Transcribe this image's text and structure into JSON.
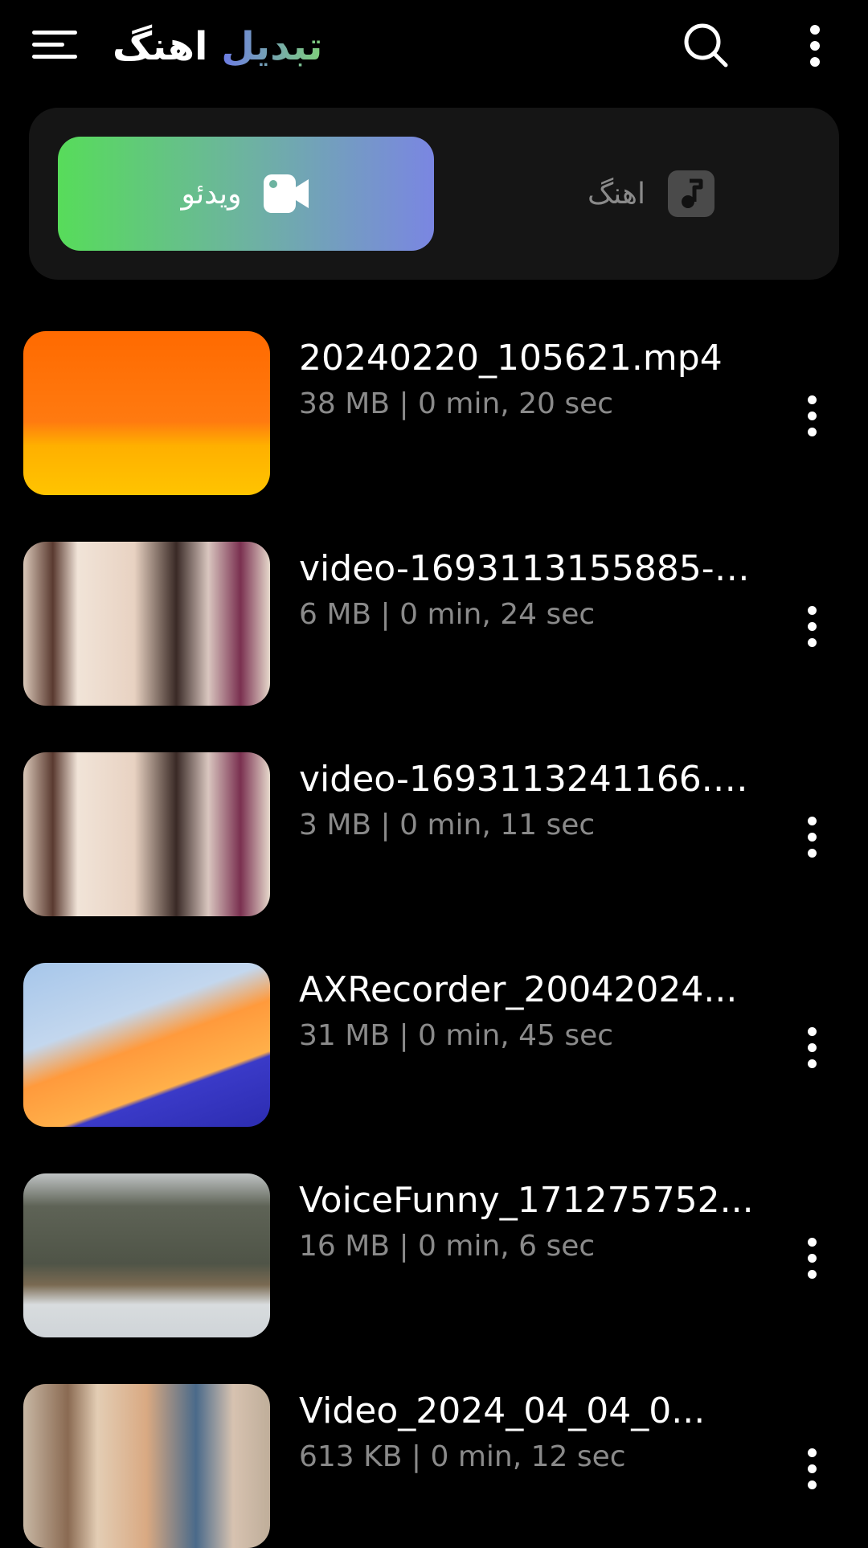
{
  "header": {
    "title_part1": "تبدیل",
    "title_part2": "اهنگ"
  },
  "tabs": [
    {
      "label": "ویدئو",
      "icon": "video-camera-icon",
      "selected": true
    },
    {
      "label": "اهنگ",
      "icon": "music-note-icon",
      "selected": false
    }
  ],
  "videos": [
    {
      "name": "20240220_105621.mp4",
      "meta": "38 MB | 0 min, 20 sec"
    },
    {
      "name": "video-1693113155885-4...",
      "meta": "6 MB | 0 min, 24 sec"
    },
    {
      "name": "video-1693113241166.m...",
      "meta": "3 MB | 0 min, 11 sec"
    },
    {
      "name": "AXRecorder_20042024...",
      "meta": "31 MB | 0 min, 45 sec"
    },
    {
      "name": "VoiceFunny_171275752...",
      "meta": "16 MB | 0 min, 6 sec"
    },
    {
      "name": "Video_2024_04_04_0...",
      "meta": "613 KB | 0 min, 12 sec"
    }
  ],
  "colors": {
    "background": "#000000",
    "panel": "#151515",
    "gradient_start": "#57dc5a",
    "gradient_end": "#7a86e2",
    "meta_text": "#8a8a8a"
  }
}
